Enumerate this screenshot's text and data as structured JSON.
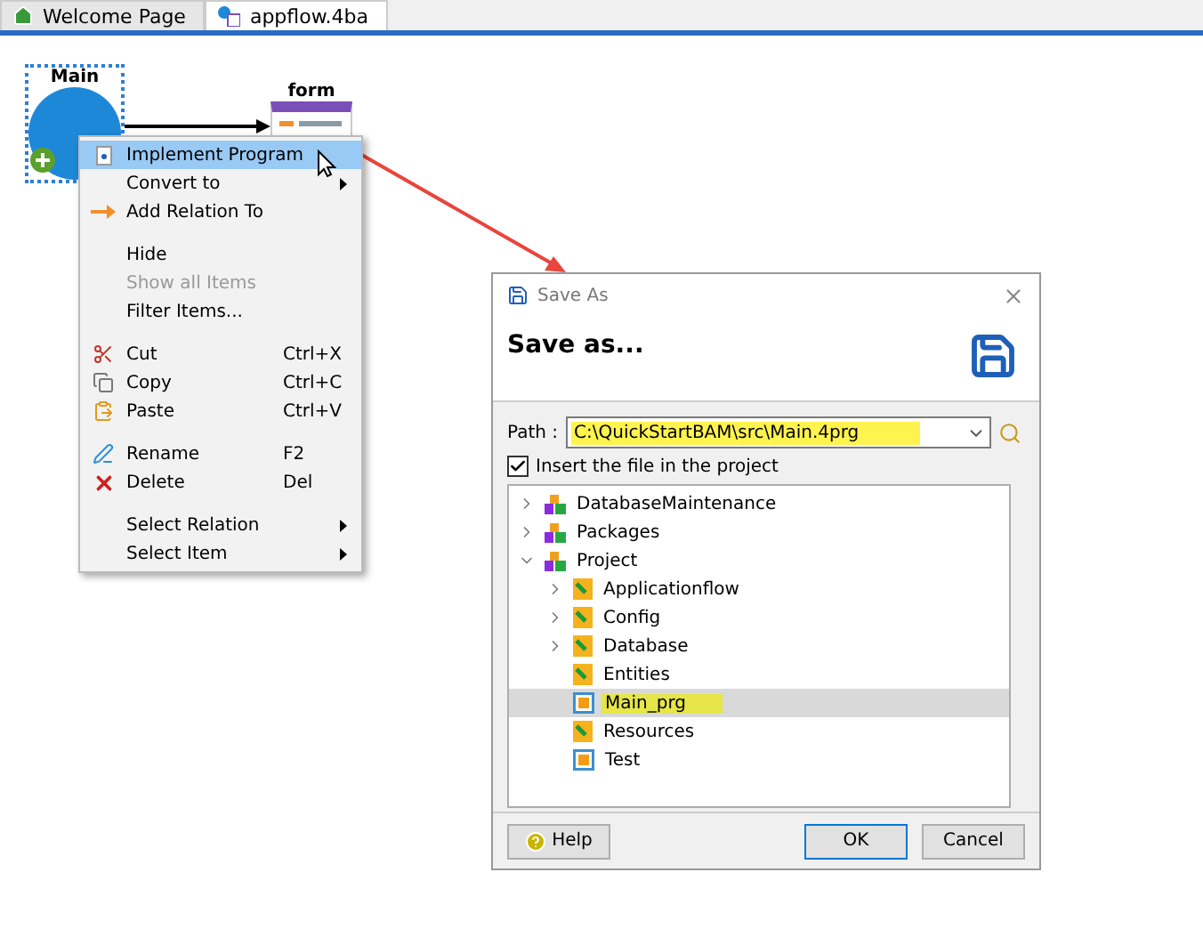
{
  "tabs": [
    {
      "label": "Welcome Page",
      "kind": "home",
      "selected": false
    },
    {
      "label": "appflow.4ba",
      "kind": "flow",
      "selected": true
    }
  ],
  "diagram": {
    "nodes": [
      {
        "label": "Main",
        "kind": "program",
        "selected": true
      },
      {
        "label": "form",
        "kind": "form",
        "selected": false
      }
    ]
  },
  "context_menu": {
    "sections": [
      [
        {
          "label": "Implement Program",
          "highlighted": true
        },
        {
          "label": "Convert to",
          "submenu": true,
          "highlighted": false
        },
        {
          "label": "Add Relation To",
          "highlighted": false
        }
      ],
      [
        {
          "label": "Hide",
          "highlighted": false
        },
        {
          "label": "Show all Items",
          "disabled": true,
          "highlighted": false
        },
        {
          "label": "Filter Items...",
          "highlighted": false
        }
      ],
      [
        {
          "label": "Cut",
          "shortcut": "Ctrl+X",
          "highlighted": false
        },
        {
          "label": "Copy",
          "shortcut": "Ctrl+C",
          "highlighted": false
        },
        {
          "label": "Paste",
          "shortcut": "Ctrl+V",
          "highlighted": false
        }
      ],
      [
        {
          "label": "Rename",
          "shortcut": "F2",
          "highlighted": false
        },
        {
          "label": "Delete",
          "shortcut": "Del",
          "highlighted": false
        }
      ],
      [
        {
          "label": "Select Relation",
          "submenu": true,
          "highlighted": false
        },
        {
          "label": "Select Item",
          "submenu": true,
          "highlighted": false
        }
      ]
    ]
  },
  "dialog": {
    "title": "Save As",
    "heading": "Save as...",
    "path_label": "Path :",
    "path_value": "C:\\QuickStartBAM\\src\\Main.4prg",
    "path_highlighted": true,
    "insert_checkbox": {
      "label": "Insert the file in the project",
      "checked": true
    },
    "tree": [
      {
        "label": "DatabaseMaintenance",
        "kind": "package",
        "expanded": false,
        "selected": false
      },
      {
        "label": "Packages",
        "kind": "package",
        "expanded": false,
        "selected": false
      },
      {
        "label": "Project",
        "kind": "package",
        "expanded": true,
        "selected": false,
        "children": [
          {
            "label": "Applicationflow",
            "kind": "folder",
            "expanded": false,
            "selected": false
          },
          {
            "label": "Config",
            "kind": "folder",
            "expanded": false,
            "selected": false
          },
          {
            "label": "Database",
            "kind": "folder",
            "expanded": false,
            "selected": false
          },
          {
            "label": "Entities",
            "kind": "folder",
            "selected": false
          },
          {
            "label": "Main_prg",
            "kind": "file",
            "selected": true,
            "highlighted": true
          },
          {
            "label": "Resources",
            "kind": "folder",
            "selected": false
          },
          {
            "label": "Test",
            "kind": "file",
            "selected": false
          }
        ]
      }
    ],
    "buttons": [
      {
        "label": "Help",
        "kind": "help",
        "default": false
      },
      {
        "label": "OK",
        "kind": "plain",
        "default": true
      },
      {
        "label": "Cancel",
        "kind": "plain",
        "default": false
      }
    ]
  }
}
